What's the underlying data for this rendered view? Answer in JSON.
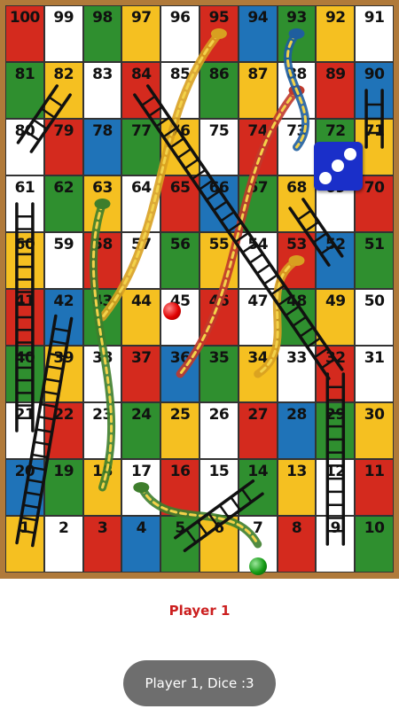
{
  "board": {
    "rows": [
      [
        100,
        99,
        98,
        97,
        96,
        95,
        94,
        93,
        92,
        91
      ],
      [
        81,
        82,
        83,
        84,
        85,
        86,
        87,
        88,
        89,
        90
      ],
      [
        80,
        79,
        78,
        77,
        76,
        75,
        74,
        73,
        72,
        71
      ],
      [
        61,
        62,
        63,
        64,
        65,
        66,
        67,
        68,
        69,
        70
      ],
      [
        60,
        59,
        58,
        57,
        56,
        55,
        54,
        53,
        52,
        51
      ],
      [
        41,
        42,
        43,
        44,
        45,
        46,
        47,
        48,
        49,
        50
      ],
      [
        40,
        39,
        38,
        37,
        36,
        35,
        34,
        33,
        32,
        31
      ],
      [
        21,
        22,
        23,
        24,
        25,
        26,
        27,
        28,
        29,
        30
      ],
      [
        20,
        19,
        18,
        17,
        16,
        15,
        14,
        13,
        12,
        11
      ],
      [
        1,
        2,
        3,
        4,
        5,
        6,
        7,
        8,
        9,
        10
      ]
    ],
    "colors": {
      "red": "#d42a1e",
      "white": "#ffffff",
      "green": "#2f8f2f",
      "yellow": "#f5c021",
      "blue": "#1f73b8"
    },
    "pattern": [
      "red",
      "white",
      "green",
      "yellow",
      "white",
      "red",
      "blue",
      "green",
      "yellow",
      "white"
    ],
    "ladders": [
      {
        "from": 21,
        "to": 61
      },
      {
        "from": 1,
        "to": 42
      },
      {
        "from": 32,
        "to": 84
      },
      {
        "from": 5,
        "to": 14
      },
      {
        "from": 9,
        "to": 32
      },
      {
        "from": 52,
        "to": 68
      },
      {
        "from": 71,
        "to": 90
      },
      {
        "from": 80,
        "to": 82
      }
    ],
    "snakes": [
      {
        "head": 95,
        "tail": 43
      },
      {
        "head": 63,
        "tail": 18
      },
      {
        "head": 88,
        "tail": 36
      },
      {
        "head": 93,
        "tail": 73
      },
      {
        "head": 53,
        "tail": 34
      },
      {
        "head": 17,
        "tail": 7
      }
    ],
    "snake_colors": [
      "#d8a020",
      "#3e7e2c",
      "#c0392b",
      "#1f5e9e"
    ]
  },
  "dice": {
    "value": 3,
    "color": "#1a2fc9"
  },
  "tokens": [
    {
      "player": "red",
      "position": 45
    },
    {
      "player": "green",
      "position": 7
    }
  ],
  "player_label": "Player 1",
  "toast": "Player 1, Dice :3"
}
